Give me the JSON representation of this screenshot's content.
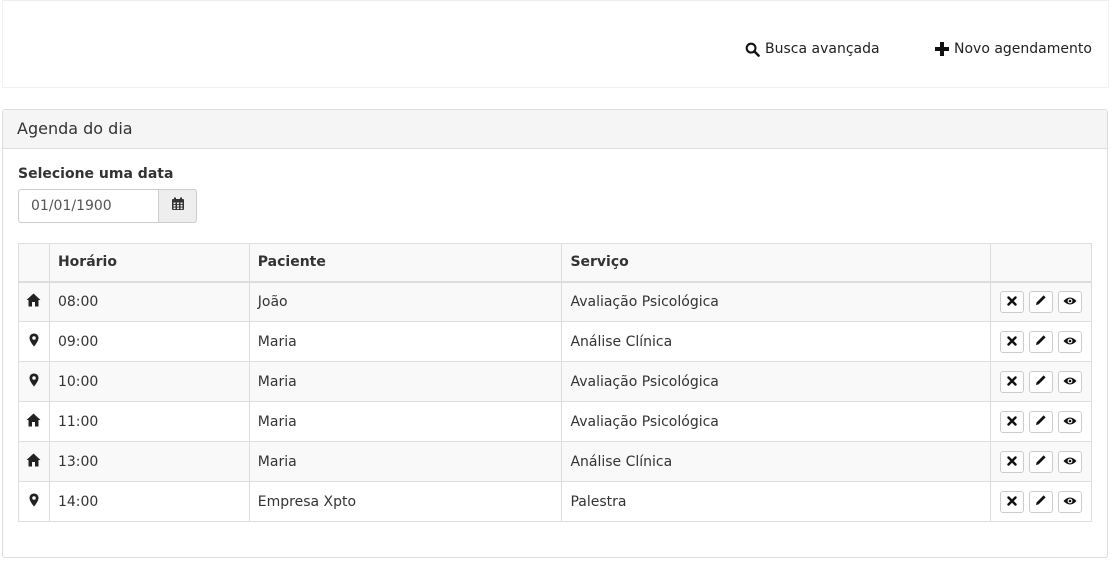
{
  "navbar": {
    "search_label": "Busca avançada",
    "search_icon": "search-icon",
    "new_label": "Novo agendamento",
    "new_icon": "plus-icon"
  },
  "panel": {
    "title": "Agenda do dia",
    "date_label": "Selecione uma data",
    "date_value": "01/01/1900",
    "calendar_icon": "calendar-icon"
  },
  "table": {
    "headers": [
      "",
      "Horário",
      "Paciente",
      "Serviço",
      ""
    ],
    "rows": [
      {
        "icon": "home-icon",
        "time": "08:00",
        "patient": "João",
        "service": "Avaliação Psicológica"
      },
      {
        "icon": "map-marker-icon",
        "time": "09:00",
        "patient": "Maria",
        "service": "Análise Clínica"
      },
      {
        "icon": "map-marker-icon",
        "time": "10:00",
        "patient": "Maria",
        "service": "Avaliação Psicológica"
      },
      {
        "icon": "home-icon",
        "time": "11:00",
        "patient": "Maria",
        "service": "Avaliação Psicológica"
      },
      {
        "icon": "home-icon",
        "time": "13:00",
        "patient": "Maria",
        "service": "Análise Clínica"
      },
      {
        "icon": "map-marker-icon",
        "time": "14:00",
        "patient": "Empresa Xpto",
        "service": "Palestra"
      }
    ],
    "row_actions": [
      "remove-icon",
      "pencil-icon",
      "eye-icon"
    ]
  }
}
